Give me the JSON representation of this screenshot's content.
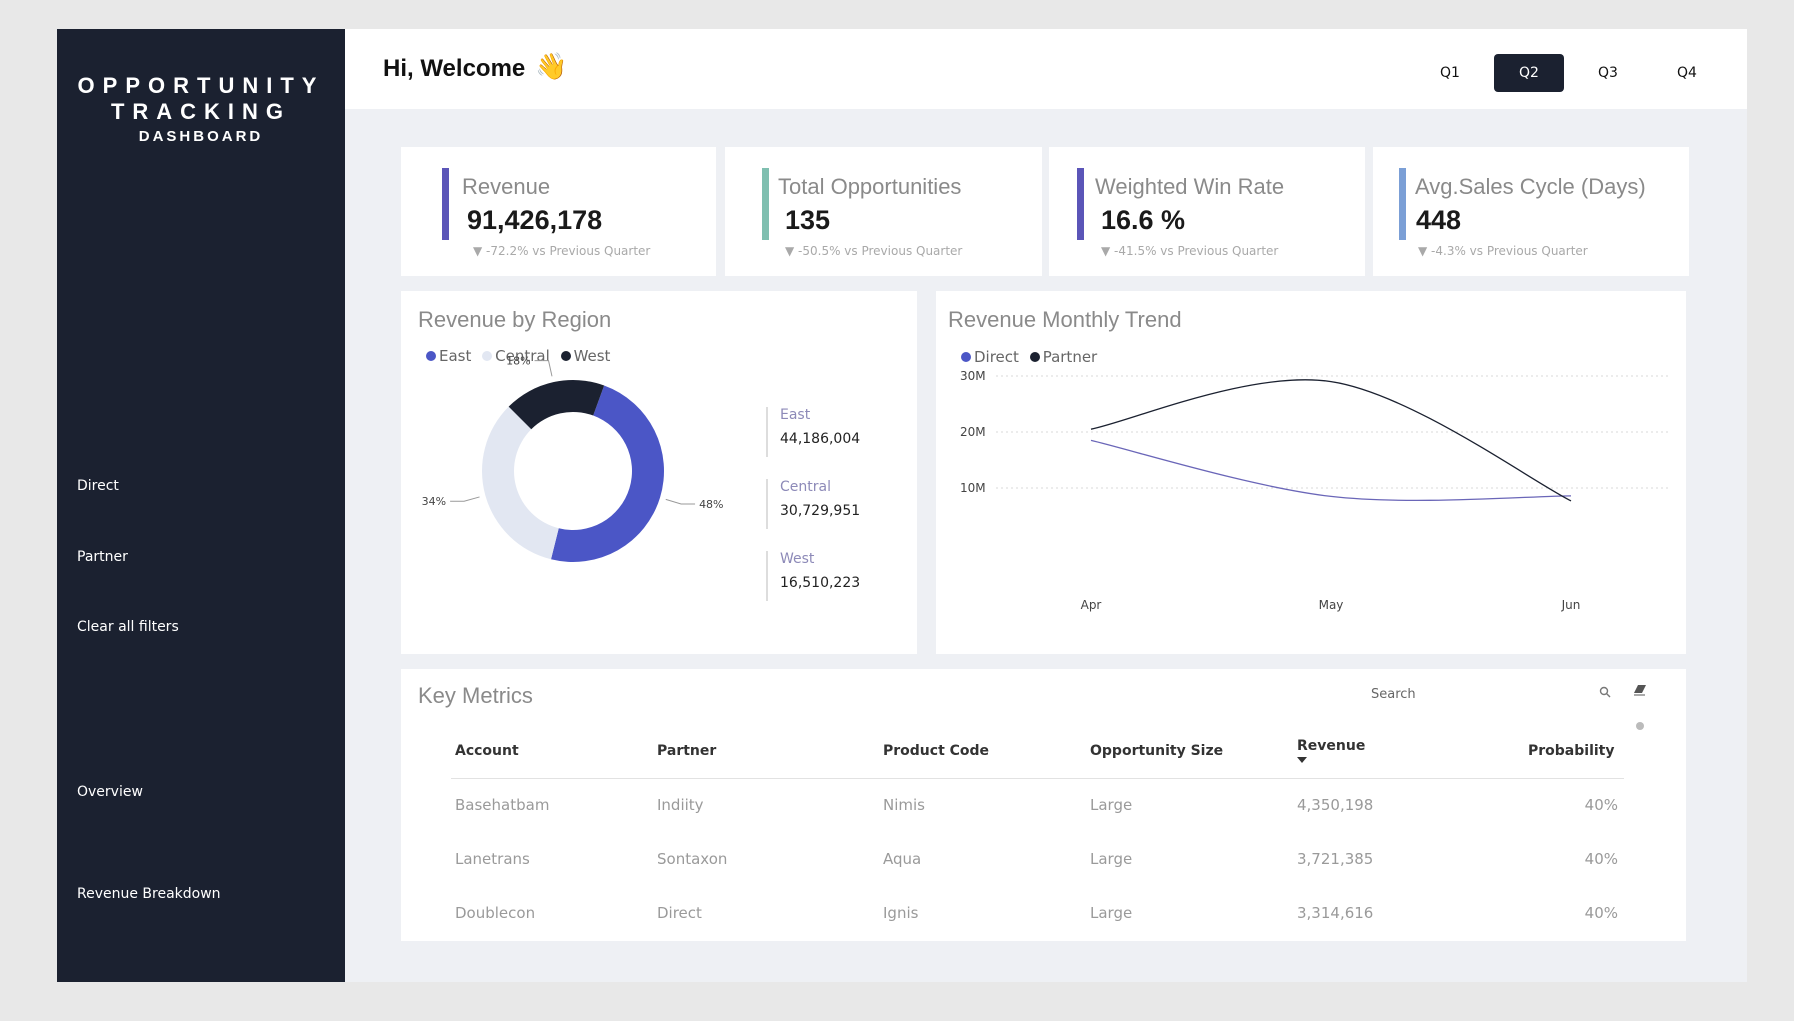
{
  "brand": {
    "line1": "OPPORTUNITY",
    "line2": "TRACKING",
    "line3": "DASHBOARD"
  },
  "sidebar": {
    "items": [
      {
        "label": "Direct"
      },
      {
        "label": "Partner"
      },
      {
        "label": "Clear all filters"
      },
      {
        "label": "Overview"
      },
      {
        "label": "Revenue Breakdown"
      }
    ]
  },
  "header": {
    "welcome": "Hi, Welcome",
    "wave_emoji": "👋",
    "quarters": [
      "Q1",
      "Q2",
      "Q3",
      "Q4"
    ],
    "selected_quarter": "Q2"
  },
  "kpis": [
    {
      "title": "Revenue",
      "value": "91,426,178",
      "delta": "▼ -72.2% vs Previous Quarter",
      "color": "#5b55b8"
    },
    {
      "title": "Total Opportunities",
      "value": "135",
      "delta": "▼ -50.5% vs Previous Quarter",
      "color": "#7fbfb0"
    },
    {
      "title": "Weighted Win Rate",
      "value": "16.6 %",
      "delta": "▼ -41.5% vs Previous Quarter",
      "color": "#5b55b8"
    },
    {
      "title": "Avg.Sales Cycle (Days)",
      "value": "448",
      "delta": "▼ -4.3% vs Previous Quarter",
      "color": "#7b9fd6"
    }
  ],
  "region_panel": {
    "title": "Revenue by Region",
    "legend": [
      {
        "name": "East",
        "color": "#4b56c6"
      },
      {
        "name": "Central",
        "color": "#e2e7f2"
      },
      {
        "name": "West",
        "color": "#1b2130"
      }
    ],
    "regions": [
      {
        "name": "East",
        "value": "44,186,004"
      },
      {
        "name": "Central",
        "value": "30,729,951"
      },
      {
        "name": "West",
        "value": "16,510,223"
      }
    ]
  },
  "trend_panel": {
    "title": "Revenue Monthly Trend",
    "legend": [
      {
        "name": "Direct",
        "color": "#4b56c6"
      },
      {
        "name": "Partner",
        "color": "#1b2130"
      }
    ]
  },
  "chart_data": [
    {
      "type": "pie",
      "title": "Revenue by Region",
      "donut": true,
      "categories": [
        "East",
        "Central",
        "West"
      ],
      "values": [
        44186004,
        30729951,
        16510223
      ],
      "labels": [
        "48%",
        "34%",
        "18%"
      ],
      "colors": [
        "#4b56c6",
        "#e2e7f2",
        "#1b2130"
      ]
    },
    {
      "type": "line",
      "title": "Revenue Monthly Trend",
      "categories": [
        "Apr",
        "May",
        "Jun"
      ],
      "ylim": [
        0,
        30000000
      ],
      "yticks": [
        10000000,
        20000000,
        30000000
      ],
      "ytick_labels": [
        "10M",
        "20M",
        "30M"
      ],
      "grid": true,
      "legend_position": "top-left",
      "series": [
        {
          "name": "Direct",
          "values": [
            18500000,
            8500000,
            8600000
          ],
          "color": "#6a66b8"
        },
        {
          "name": "Partner",
          "values": [
            20500000,
            29000000,
            7700000
          ],
          "color": "#1b2130"
        }
      ]
    }
  ],
  "key_metrics": {
    "title": "Key Metrics",
    "search_placeholder": "Search",
    "columns": [
      "Account",
      "Partner",
      "Product Code",
      "Opportunity Size",
      "Revenue",
      "Probability"
    ],
    "rows": [
      [
        "Basehatbam",
        "Indiity",
        "Nimis",
        "Large",
        "4,350,198",
        "40%"
      ],
      [
        "Lanetrans",
        "Sontaxon",
        "Aqua",
        "Large",
        "3,721,385",
        "40%"
      ],
      [
        "Doublecon",
        "Direct",
        "Ignis",
        "Large",
        "3,314,616",
        "40%"
      ]
    ]
  }
}
